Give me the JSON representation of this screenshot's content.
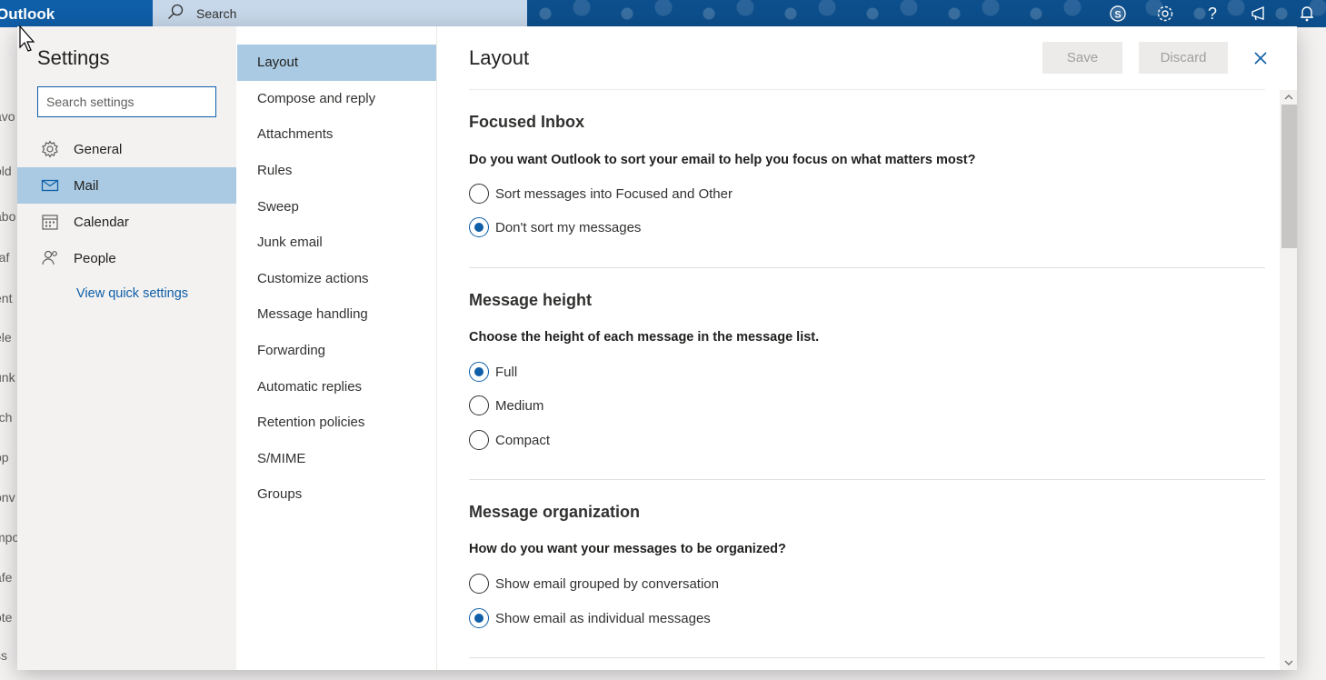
{
  "app": {
    "name": "Outlook",
    "search_label": "Search"
  },
  "left_strip": [
    "avo",
    "old",
    "abo",
    "raf",
    "ent",
    "ele",
    "unk",
    "rch",
    "pp",
    "onv",
    "mpo",
    "afe",
    "ote",
    "ss"
  ],
  "settings": {
    "title": "Settings",
    "search_placeholder": "Search settings",
    "nav": [
      {
        "label": "General",
        "icon": "gear-icon"
      },
      {
        "label": "Mail",
        "icon": "mail-icon",
        "active": true
      },
      {
        "label": "Calendar",
        "icon": "calendar-icon"
      },
      {
        "label": "People",
        "icon": "people-icon"
      }
    ],
    "quick_settings_link": "View quick settings"
  },
  "mail_nav": [
    "Layout",
    "Compose and reply",
    "Attachments",
    "Rules",
    "Sweep",
    "Junk email",
    "Customize actions",
    "Message handling",
    "Forwarding",
    "Automatic replies",
    "Retention policies",
    "S/MIME",
    "Groups"
  ],
  "layout": {
    "title": "Layout",
    "save_label": "Save",
    "discard_label": "Discard",
    "focused_inbox": {
      "heading": "Focused Inbox",
      "question": "Do you want Outlook to sort your email to help you focus on what matters most?",
      "options": [
        "Sort messages into Focused and Other",
        "Don't sort my messages"
      ],
      "selected": 1
    },
    "message_height": {
      "heading": "Message height",
      "question": "Choose the height of each message in the message list.",
      "options": [
        "Full",
        "Medium",
        "Compact"
      ],
      "selected": 0
    },
    "message_organization": {
      "heading": "Message organization",
      "question": "How do you want your messages to be organized?",
      "options": [
        "Show email grouped by conversation",
        "Show email as individual messages"
      ],
      "selected": 1
    }
  },
  "colors": {
    "accent": "#0f5ea8",
    "nav_active": "#a9cae2",
    "topbar": "#0f5ea8"
  }
}
